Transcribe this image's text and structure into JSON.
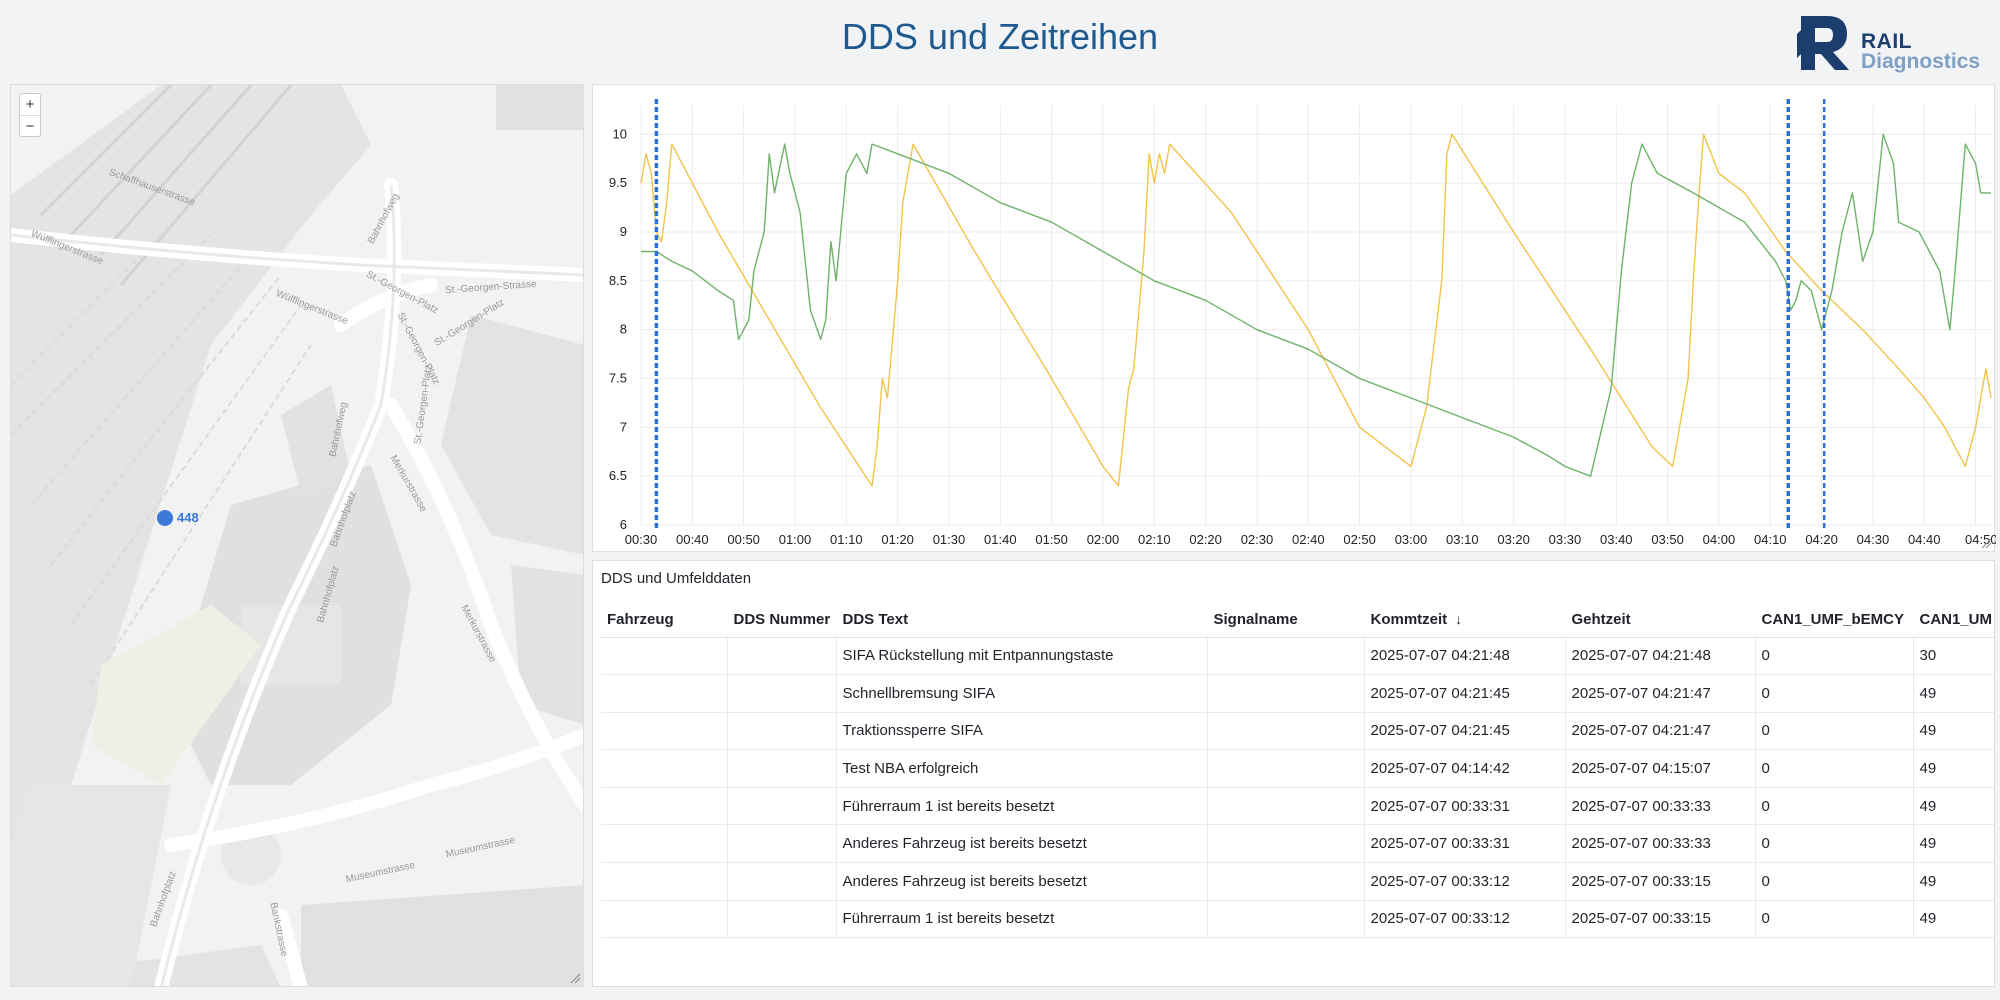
{
  "header": {
    "title": "DDS und Zeitreihen",
    "logo": {
      "word1": "RAIL",
      "word2": "Diagnostics",
      "colors": {
        "dark": "#1c3e6e",
        "light": "#7f9fc4"
      }
    }
  },
  "map": {
    "zoom_in": "+",
    "zoom_out": "−",
    "marker_label": "448",
    "marker_color": "#3b78d8",
    "street_labels": [
      {
        "text": "Schaffhauserstrasse",
        "x": 140,
        "y": 105,
        "rot": 20
      },
      {
        "text": "Wülflingerstrasse",
        "x": 55,
        "y": 165,
        "rot": 22
      },
      {
        "text": "Wülflingerstrasse",
        "x": 300,
        "y": 225,
        "rot": 22
      },
      {
        "text": "Bahnhofweg",
        "x": 375,
        "y": 135,
        "rot": -62
      },
      {
        "text": "St.-Georgen-Strasse",
        "x": 480,
        "y": 205,
        "rot": -4
      },
      {
        "text": "St.-Georgen-Platz",
        "x": 390,
        "y": 210,
        "rot": 28
      },
      {
        "text": "St.-Georgen-Platz",
        "x": 405,
        "y": 265,
        "rot": 62
      },
      {
        "text": "St.-Georgen-Platz",
        "x": 460,
        "y": 240,
        "rot": -32
      },
      {
        "text": "St.-Georgen-Platz",
        "x": 415,
        "y": 320,
        "rot": -82
      },
      {
        "text": "Merkurstrasse",
        "x": 395,
        "y": 400,
        "rot": 60
      },
      {
        "text": "Merkurstrasse",
        "x": 465,
        "y": 550,
        "rot": 62
      },
      {
        "text": "Bahnhofweg",
        "x": 330,
        "y": 345,
        "rot": -78
      },
      {
        "text": "Bahnhofplatz",
        "x": 335,
        "y": 435,
        "rot": -70
      },
      {
        "text": "Bahnhofplatz",
        "x": 320,
        "y": 510,
        "rot": -74
      },
      {
        "text": "Museumstrasse",
        "x": 370,
        "y": 790,
        "rot": -12
      },
      {
        "text": "Museumstrasse",
        "x": 470,
        "y": 765,
        "rot": -12
      },
      {
        "text": "Bahnhofplatz",
        "x": 155,
        "y": 815,
        "rot": -70
      },
      {
        "text": "Bankstrasse",
        "x": 265,
        "y": 845,
        "rot": 78
      }
    ]
  },
  "chart_data": {
    "type": "line",
    "x_ticks": [
      "00:30",
      "00:40",
      "00:50",
      "01:00",
      "01:10",
      "01:20",
      "01:30",
      "01:40",
      "01:50",
      "02:00",
      "02:10",
      "02:20",
      "02:30",
      "02:40",
      "02:50",
      "03:00",
      "03:10",
      "03:20",
      "03:30",
      "03:40",
      "03:50",
      "04:00",
      "04:10",
      "04:20",
      "04:30",
      "04:40",
      "04:50"
    ],
    "y_ticks": [
      "6",
      "6.5",
      "7",
      "7.5",
      "8",
      "8.5",
      "9",
      "9.5",
      "10"
    ],
    "ylim": [
      6,
      10.3
    ],
    "xlim_minutes": [
      30,
      293
    ],
    "series": [
      {
        "color": "#f2c34a",
        "points": [
          [
            30,
            9.5
          ],
          [
            31,
            9.8
          ],
          [
            32,
            9.6
          ],
          [
            33,
            9.0
          ],
          [
            34,
            8.9
          ],
          [
            35,
            9.3
          ],
          [
            36,
            9.9
          ],
          [
            45,
            9.0
          ],
          [
            55,
            8.1
          ],
          [
            65,
            7.2
          ],
          [
            75,
            6.4
          ],
          [
            76,
            6.8
          ],
          [
            77,
            7.5
          ],
          [
            78,
            7.3
          ],
          [
            80,
            8.5
          ],
          [
            81,
            9.3
          ],
          [
            83,
            9.9
          ],
          [
            95,
            8.8
          ],
          [
            110,
            7.5
          ],
          [
            120,
            6.6
          ],
          [
            123,
            6.4
          ],
          [
            125,
            7.4
          ],
          [
            126,
            7.6
          ],
          [
            128,
            8.8
          ],
          [
            129,
            9.8
          ],
          [
            130,
            9.5
          ],
          [
            131,
            9.8
          ],
          [
            132,
            9.6
          ],
          [
            133,
            9.9
          ],
          [
            145,
            9.2
          ],
          [
            160,
            8.0
          ],
          [
            170,
            7.0
          ],
          [
            180,
            6.6
          ],
          [
            183,
            7.2
          ],
          [
            186,
            8.5
          ],
          [
            187,
            9.8
          ],
          [
            188,
            10.0
          ],
          [
            200,
            9.0
          ],
          [
            215,
            7.8
          ],
          [
            227,
            6.8
          ],
          [
            231,
            6.6
          ],
          [
            234,
            7.5
          ],
          [
            235,
            8.5
          ],
          [
            236,
            9.3
          ],
          [
            237,
            10.0
          ],
          [
            240,
            9.6
          ],
          [
            245,
            9.4
          ],
          [
            253,
            8.8
          ],
          [
            260,
            8.4
          ],
          [
            268,
            8.0
          ],
          [
            275,
            7.6
          ],
          [
            280,
            7.3
          ],
          [
            284,
            7.0
          ],
          [
            288,
            6.6
          ],
          [
            290,
            7.0
          ],
          [
            292,
            7.6
          ],
          [
            293,
            7.3
          ]
        ]
      },
      {
        "color": "#6fb26b",
        "points": [
          [
            30,
            8.8
          ],
          [
            33,
            8.8
          ],
          [
            36,
            8.7
          ],
          [
            40,
            8.6
          ],
          [
            45,
            8.4
          ],
          [
            48,
            8.3
          ],
          [
            49,
            7.9
          ],
          [
            51,
            8.1
          ],
          [
            52,
            8.6
          ],
          [
            54,
            9.0
          ],
          [
            55,
            9.8
          ],
          [
            56,
            9.4
          ],
          [
            58,
            9.9
          ],
          [
            59,
            9.6
          ],
          [
            61,
            9.2
          ],
          [
            63,
            8.2
          ],
          [
            65,
            7.9
          ],
          [
            66,
            8.1
          ],
          [
            67,
            8.9
          ],
          [
            68,
            8.5
          ],
          [
            70,
            9.6
          ],
          [
            72,
            9.8
          ],
          [
            74,
            9.6
          ],
          [
            75,
            9.9
          ],
          [
            80,
            9.8
          ],
          [
            90,
            9.6
          ],
          [
            100,
            9.3
          ],
          [
            110,
            9.1
          ],
          [
            120,
            8.8
          ],
          [
            130,
            8.5
          ],
          [
            140,
            8.3
          ],
          [
            150,
            8.0
          ],
          [
            160,
            7.8
          ],
          [
            170,
            7.5
          ],
          [
            180,
            7.3
          ],
          [
            190,
            7.1
          ],
          [
            200,
            6.9
          ],
          [
            207,
            6.7
          ],
          [
            210,
            6.6
          ],
          [
            215,
            6.5
          ],
          [
            219,
            7.4
          ],
          [
            221,
            8.6
          ],
          [
            223,
            9.5
          ],
          [
            225,
            9.9
          ],
          [
            228,
            9.6
          ],
          [
            235,
            9.4
          ],
          [
            245,
            9.1
          ],
          [
            251,
            8.7
          ],
          [
            253,
            8.5
          ],
          [
            254,
            8.2
          ],
          [
            255,
            8.3
          ],
          [
            256,
            8.5
          ],
          [
            258,
            8.4
          ],
          [
            260,
            8.0
          ],
          [
            262,
            8.4
          ],
          [
            264,
            9.0
          ],
          [
            266,
            9.4
          ],
          [
            268,
            8.7
          ],
          [
            270,
            9.0
          ],
          [
            271,
            9.5
          ],
          [
            272,
            10.0
          ],
          [
            274,
            9.7
          ],
          [
            275,
            9.1
          ],
          [
            279,
            9.0
          ],
          [
            283,
            8.6
          ],
          [
            285,
            8.0
          ],
          [
            286,
            8.6
          ],
          [
            288,
            9.9
          ],
          [
            290,
            9.7
          ],
          [
            291,
            9.4
          ],
          [
            293,
            9.4
          ]
        ]
      }
    ],
    "markers_minutes": [
      33,
      253.5,
      260.5
    ]
  },
  "table": {
    "title": "DDS und Umfelddaten",
    "columns": [
      "Fahrzeug",
      "DDS Nummer",
      "DDS Text",
      "Signalname",
      "Kommtzeit",
      "Gehtzeit",
      "CAN1_UMF_bEMCY",
      "CAN1_UM"
    ],
    "sort_indicator": "↓",
    "rows": [
      [
        "",
        "",
        "SIFA Rückstellung mit Entpannungstaste",
        "",
        "2025-07-07 04:21:48",
        "2025-07-07 04:21:48",
        "0",
        "30"
      ],
      [
        "",
        "",
        "Schnellbremsung SIFA",
        "",
        "2025-07-07 04:21:45",
        "2025-07-07 04:21:47",
        "0",
        "49"
      ],
      [
        "",
        "",
        "Traktionssperre SIFA",
        "",
        "2025-07-07 04:21:45",
        "2025-07-07 04:21:47",
        "0",
        "49"
      ],
      [
        "",
        "",
        "Test NBA erfolgreich",
        "",
        "2025-07-07 04:14:42",
        "2025-07-07 04:15:07",
        "0",
        "49"
      ],
      [
        "",
        "",
        "Führerraum 1 ist bereits besetzt",
        "",
        "2025-07-07 00:33:31",
        "2025-07-07 00:33:33",
        "0",
        "49"
      ],
      [
        "",
        "",
        "Anderes Fahrzeug ist bereits besetzt",
        "",
        "2025-07-07 00:33:31",
        "2025-07-07 00:33:33",
        "0",
        "49"
      ],
      [
        "",
        "",
        "Anderes Fahrzeug ist bereits besetzt",
        "",
        "2025-07-07 00:33:12",
        "2025-07-07 00:33:15",
        "0",
        "49"
      ],
      [
        "",
        "",
        "Führerraum 1 ist bereits besetzt",
        "",
        "2025-07-07 00:33:12",
        "2025-07-07 00:33:15",
        "0",
        "49"
      ]
    ]
  }
}
